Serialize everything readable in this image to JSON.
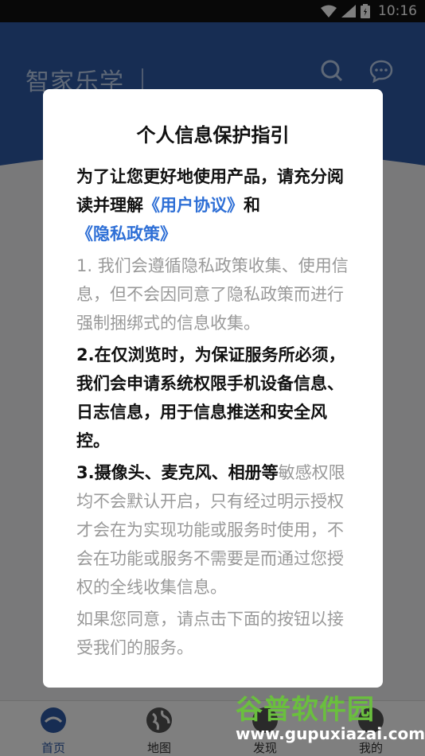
{
  "status_bar": {
    "time": "10:16"
  },
  "header": {
    "title": "智家乐学"
  },
  "tabs": [
    {
      "label": "首页",
      "icon": "home-icon",
      "active": true
    },
    {
      "label": "地图",
      "icon": "globe-icon",
      "active": false
    },
    {
      "label": "发现",
      "icon": "discover-icon",
      "active": false
    },
    {
      "label": "我的",
      "icon": "profile-icon",
      "active": false
    }
  ],
  "dialog": {
    "title": "个人信息保护指引",
    "intro": "为了让您更好地使用产品，请充分阅读并理解",
    "user_agreement_link": "《用户协议》",
    "and": "和",
    "privacy_policy_link": "《隐私政策》",
    "item1": "1. 我们会遵循隐私政策收集、使用信息，但不会因同意了隐私政策而进行强制捆绑式的信息收集。",
    "item2": "2.在仅浏览时，为保证服务所必须，我们会申请系统权限手机设备信息、日志信息，用于信息推送和安全风控。",
    "item3_bold": "3.摄像头、麦克风、相册等",
    "item3_rest": "敏感权限均不会默认开启，只有经过明示授权才会在为实现功能或服务时使用，不会在功能或服务不需要是而通过您授权的全线收集信息。",
    "footer": "如果您同意，请点击下面的按钮以接受我们的服务。"
  },
  "watermark": {
    "logo": "谷普软件园",
    "url": "www.gupuxiazai.com"
  },
  "colors": {
    "brand_blue": "#2e5aa6",
    "link_blue": "#2e6fd6",
    "watermark_green": "#6abf3e"
  }
}
